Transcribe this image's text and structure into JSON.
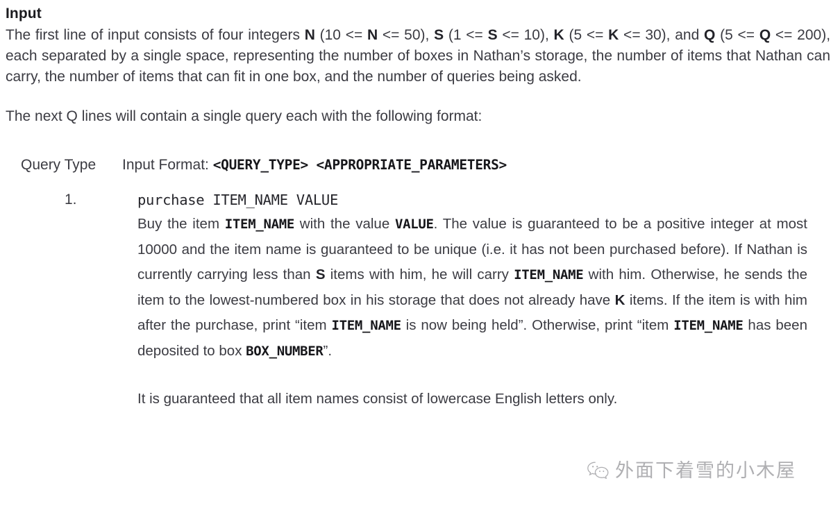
{
  "document": {
    "section_heading": "Input",
    "intro_paragraph": {
      "segments": [
        {
          "t": "The first line of input consists of four integers ",
          "s": "normal"
        },
        {
          "t": "N",
          "s": "bold"
        },
        {
          "t": " (10 <= ",
          "s": "normal"
        },
        {
          "t": "N",
          "s": "bold"
        },
        {
          "t": " <= 50), ",
          "s": "normal"
        },
        {
          "t": "S",
          "s": "bold"
        },
        {
          "t": " (1 <= ",
          "s": "normal"
        },
        {
          "t": "S",
          "s": "bold"
        },
        {
          "t": " <= 10), ",
          "s": "normal"
        },
        {
          "t": "K",
          "s": "bold"
        },
        {
          "t": " (5 <= ",
          "s": "normal"
        },
        {
          "t": "K",
          "s": "bold"
        },
        {
          "t": " <= 30), and ",
          "s": "normal"
        },
        {
          "t": "Q",
          "s": "bold"
        },
        {
          "t": " (5 <= ",
          "s": "normal"
        },
        {
          "t": "Q",
          "s": "bold"
        },
        {
          "t": " <= 200), each separated by a single space, representing the number of boxes in Nathan’s storage, the number of items that Nathan can carry, the number of items that can fit in one box, and the number of queries being asked.",
          "s": "normal"
        }
      ]
    },
    "next_q_paragraph": "The next Q lines will contain a single query each with the following format:",
    "query_table_header": {
      "type_column": "Query Type",
      "format_label": "Input Format: ",
      "format_mono": "<QUERY_TYPE> <APPROPRIATE_PARAMETERS>"
    },
    "queries": [
      {
        "number": "1.",
        "signature": "purchase ITEM_NAME VALUE",
        "description_segments": [
          {
            "t": "Buy the item ",
            "s": "normal"
          },
          {
            "t": "ITEM_NAME",
            "s": "mono-bold"
          },
          {
            "t": " with the value ",
            "s": "normal"
          },
          {
            "t": "VALUE",
            "s": "mono-bold"
          },
          {
            "t": ". The value is guaranteed to be a positive integer at most 10000 and the item name is guaranteed to be unique (i.e. it has not been purchased before). If Nathan is currently carrying less than ",
            "s": "normal"
          },
          {
            "t": "S",
            "s": "bold"
          },
          {
            "t": " items with him, he will carry ",
            "s": "normal"
          },
          {
            "t": "ITEM_NAME",
            "s": "mono-bold"
          },
          {
            "t": " with him. Otherwise, he sends the item to the lowest-numbered box in his storage that does not already have ",
            "s": "normal"
          },
          {
            "t": "K",
            "s": "bold"
          },
          {
            "t": " items. If the item is with him after the purchase, print “item ",
            "s": "normal"
          },
          {
            "t": "ITEM_NAME",
            "s": "mono-bold"
          },
          {
            "t": " is now being held”. Otherwise, print “item ",
            "s": "normal"
          },
          {
            "t": "ITEM_NAME",
            "s": "mono-bold"
          },
          {
            "t": " has been deposited to box ",
            "s": "normal"
          },
          {
            "t": "BOX_NUMBER",
            "s": "mono-bold"
          },
          {
            "t": "”.",
            "s": "normal"
          }
        ],
        "guarantee_note": "It is guaranteed that all item names consist of lowercase English letters only."
      }
    ]
  },
  "watermark": {
    "icon": "wechat-icon",
    "text": "外面下着雪的小木屋"
  },
  "colors": {
    "background": "#ffffff",
    "heading": "#1b1b1f",
    "body_text": "#3b3b42",
    "emphasis": "#232329",
    "watermark": "#6f6f74"
  }
}
